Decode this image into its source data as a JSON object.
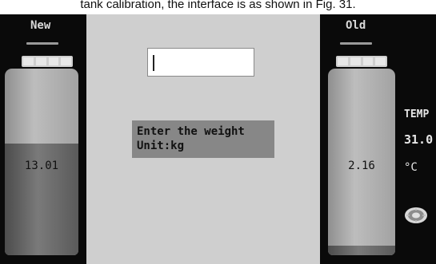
{
  "caption": "tank calibration, the interface is as shown in Fig. 31.",
  "left_tank": {
    "label": "New",
    "value": "13.01",
    "fill_level": 0.6
  },
  "right_tank": {
    "label": "Old",
    "value": "2.16",
    "fill_level": 0.05
  },
  "input": {
    "value": ""
  },
  "prompt": {
    "line1": "Enter the weight",
    "line2": "Unit:kg"
  },
  "temperature": {
    "label": "TEMP",
    "value": "31.0",
    "unit": "°C"
  },
  "icons": {
    "settings": "gear-icon"
  },
  "colors": {
    "background": "#0a0a0a",
    "center_panel": "#cfcfcf",
    "prompt_box": "#878787",
    "text_light": "#e6e6e6"
  }
}
